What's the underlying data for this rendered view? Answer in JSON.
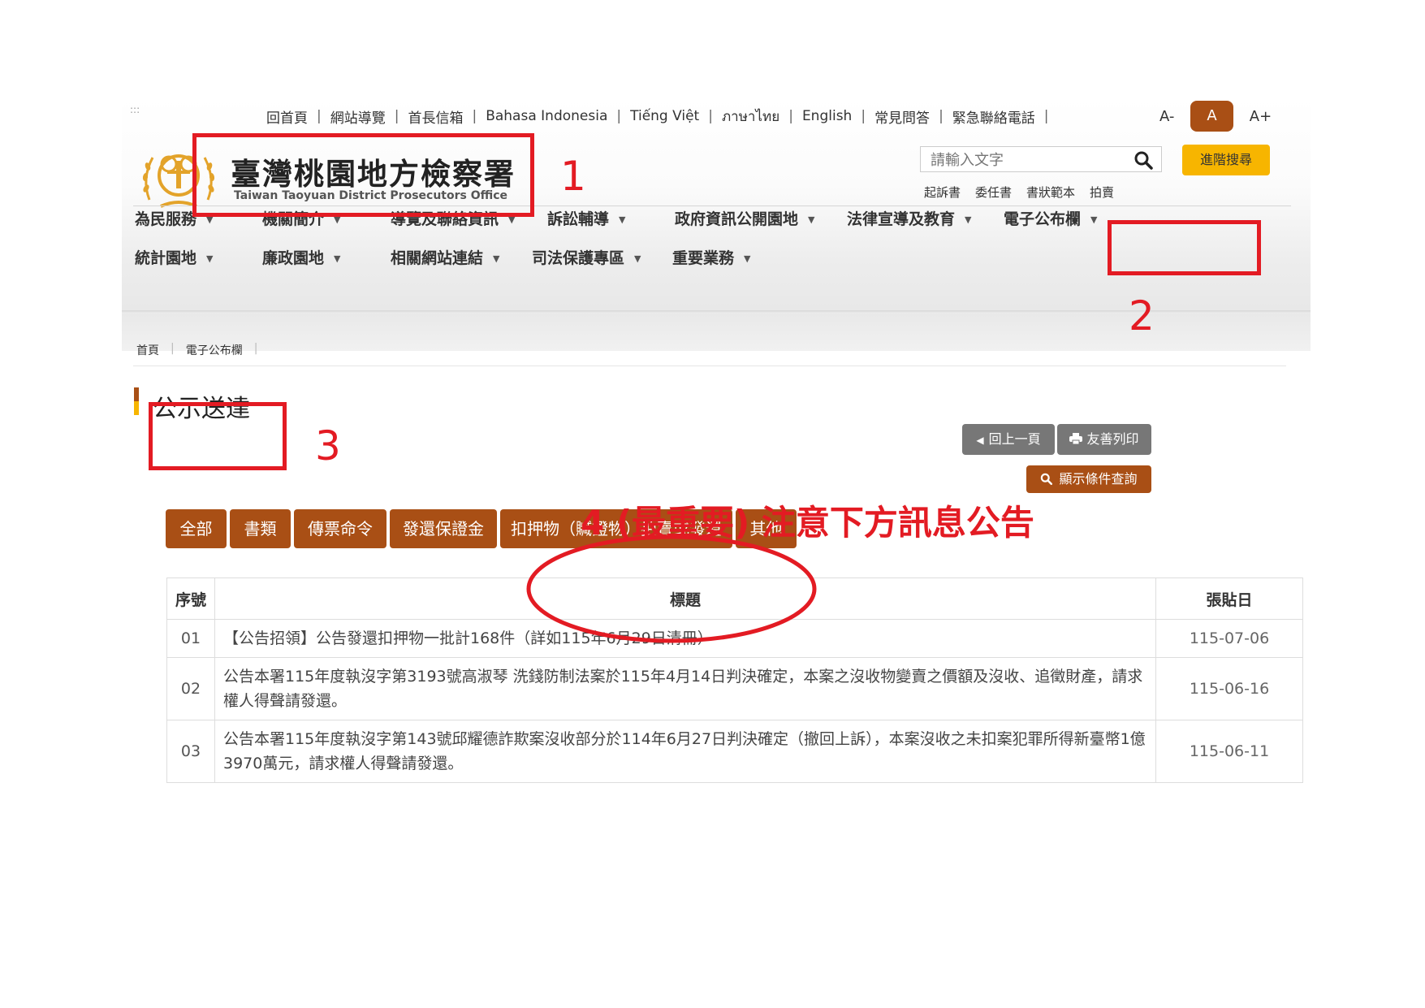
{
  "toplinks": [
    "回首頁",
    "網站導覽",
    "首長信箱",
    "Bahasa Indonesia",
    "Tiếng Việt",
    "ภาษาไทย",
    "English",
    "常見問答",
    "緊急聯絡電話"
  ],
  "font_size": {
    "small": "A-",
    "medium": "A",
    "large": "A+"
  },
  "site": {
    "title_zh": "臺灣桃園地方檢察署",
    "title_en": "Taiwan Taoyuan District Prosecutors Office"
  },
  "search": {
    "placeholder": "請輸入文字",
    "advanced_label": "進階搜尋",
    "hot": [
      "起訴書",
      "委任書",
      "書狀範本",
      "拍賣"
    ]
  },
  "nav": {
    "row1": [
      "為民服務",
      "機關簡介",
      "導覽及聯絡資訊",
      "訴訟輔導",
      "政府資訊公開園地",
      "法律宣導及教育",
      "電子公布欄"
    ],
    "row2": [
      "統計園地",
      "廉政園地",
      "相關網站連結",
      "司法保護專區",
      "重要業務"
    ]
  },
  "breadcrumb": [
    "首頁",
    "電子公布欄"
  ],
  "page_title": "公示送達",
  "actions": {
    "back": "回上一頁",
    "print": "友善列印",
    "query": "顯示條件查詢"
  },
  "tabs": [
    "全部",
    "書類",
    "傳票命令",
    "發還保證金",
    "扣押物（贓證物）拍賣或發還",
    "其他"
  ],
  "table": {
    "headers": {
      "no": "序號",
      "title": "標題",
      "date": "張貼日"
    },
    "rows": [
      {
        "no": "01",
        "title": "【公告招領】公告發還扣押物一批計168件（詳如115年6月29日清冊）",
        "date": "115-07-06"
      },
      {
        "no": "02",
        "title": "公告本署115年度執沒字第3193號高淑琴 洗錢防制法案於115年4月14日判決確定，本案之沒收物變賣之價額及沒收、追徵財產，請求權人得聲請發還。",
        "date": "115-06-16"
      },
      {
        "no": "03",
        "title": "公告本署115年度執沒字第143號邱耀德詐欺案沒收部分於114年6月27日判決確定（撤回上訴），本案沒收之未扣案犯罪所得新臺幣1億3970萬元，請求權人得聲請發還。",
        "date": "115-06-11"
      }
    ]
  },
  "annotations": {
    "n1": "1",
    "n2": "2",
    "n3": "3",
    "note": "4 (最重要) 注意下方訊息公告",
    "color": "#e31b23"
  },
  "colors": {
    "brand": "#a94f15",
    "accent": "#f7b500",
    "gray_button": "#777777"
  }
}
